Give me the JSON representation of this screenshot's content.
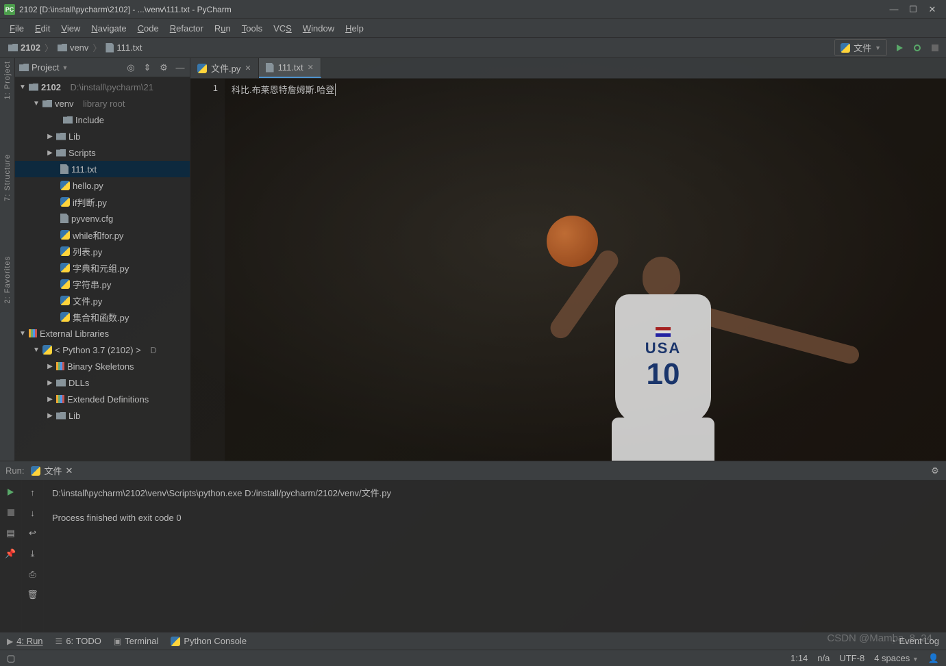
{
  "titlebar": {
    "title": "2102 [D:\\install\\pycharm\\2102] - ...\\venv\\111.txt - PyCharm"
  },
  "menu": {
    "file": "File",
    "edit": "Edit",
    "view": "View",
    "navigate": "Navigate",
    "code": "Code",
    "refactor": "Refactor",
    "run": "Run",
    "tools": "Tools",
    "vcs": "VCS",
    "window": "Window",
    "help": "Help"
  },
  "breadcrumb": {
    "root": "2102",
    "folder": "venv",
    "file": "111.txt"
  },
  "run_config": {
    "label": "文件"
  },
  "left_gutter": {
    "project": "1: Project",
    "structure": "7: Structure",
    "favorites": "2: Favorites"
  },
  "project_header": {
    "label": "Project"
  },
  "tree": {
    "root": {
      "name": "2102",
      "path": "D:\\install\\pycharm\\21"
    },
    "venv": {
      "name": "venv",
      "hint": "library root"
    },
    "include": "Include",
    "lib": "Lib",
    "scripts": "Scripts",
    "f_111": "111.txt",
    "f_hello": "hello.py",
    "f_if": "if判断.py",
    "f_cfg": "pyvenv.cfg",
    "f_while": "while和for.py",
    "f_list": "列表.py",
    "f_dict": "字典和元组.py",
    "f_str": "字符串.py",
    "f_file": "文件.py",
    "f_set": "集合和函数.py",
    "ext_lib": "External Libraries",
    "py37": "< Python 3.7 (2102) >",
    "py37_path": "D",
    "bin_skel": "Binary Skeletons",
    "dlls": "DLLs",
    "ext_def": "Extended Definitions",
    "lib2": "Lib"
  },
  "tabs": {
    "t1": "文件.py",
    "t2": "111.txt"
  },
  "editor": {
    "line": "1",
    "content": "科比.布莱恩特詹姆斯.哈登"
  },
  "run_panel": {
    "title": "Run:",
    "tab": "文件",
    "line1": "D:\\install\\pycharm\\2102\\venv\\Scripts\\python.exe D:/install/pycharm/2102/venv/文件.py",
    "line2": "Process finished with exit code 0"
  },
  "bottom": {
    "run": "4: Run",
    "todo": "6: TODO",
    "terminal": "Terminal",
    "pyconsole": "Python Console",
    "eventlog": "Event Log"
  },
  "status": {
    "pos": "1:14",
    "readonly": "n/a",
    "enc": "UTF-8",
    "indent": "4 spaces"
  },
  "watermark": "CSDN @Mamba_8_24"
}
